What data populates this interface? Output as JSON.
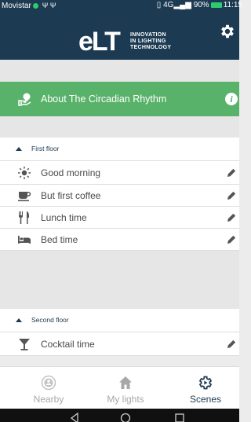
{
  "status_bar": {
    "carrier": "Movistar",
    "usb_icons": "Ψ Ψ",
    "signal": "4G",
    "battery": "90%",
    "time": "11:15"
  },
  "app_bar": {
    "logo_text": "eLT",
    "tagline": [
      "INNOVATION",
      "IN LIGHTING",
      "TECHNOLOGY"
    ]
  },
  "banner": {
    "label": "About The Circadian Rhythm",
    "info_glyph": "i",
    "color": "#59b26a"
  },
  "sections": [
    {
      "title": "First floor",
      "scenes": [
        {
          "label": "Good morning",
          "icon": "sun-icon"
        },
        {
          "label": "But first coffee",
          "icon": "coffee-cup-icon"
        },
        {
          "label": "Lunch time",
          "icon": "fork-knife-icon"
        },
        {
          "label": "Bed time",
          "icon": "bed-icon"
        }
      ]
    },
    {
      "title": "Second floor",
      "scenes": [
        {
          "label": "Cocktail time",
          "icon": "cocktail-glass-icon"
        }
      ]
    }
  ],
  "bottom_nav": {
    "items": [
      {
        "label": "Nearby",
        "icon": "nearby-icon",
        "active": false
      },
      {
        "label": "My lights",
        "icon": "home-icon",
        "active": false
      },
      {
        "label": "Scenes",
        "icon": "scenes-gear-icon",
        "active": true
      }
    ]
  },
  "colors": {
    "primary": "#1c3a52",
    "accent_green": "#59b26a",
    "background": "#ececec"
  }
}
